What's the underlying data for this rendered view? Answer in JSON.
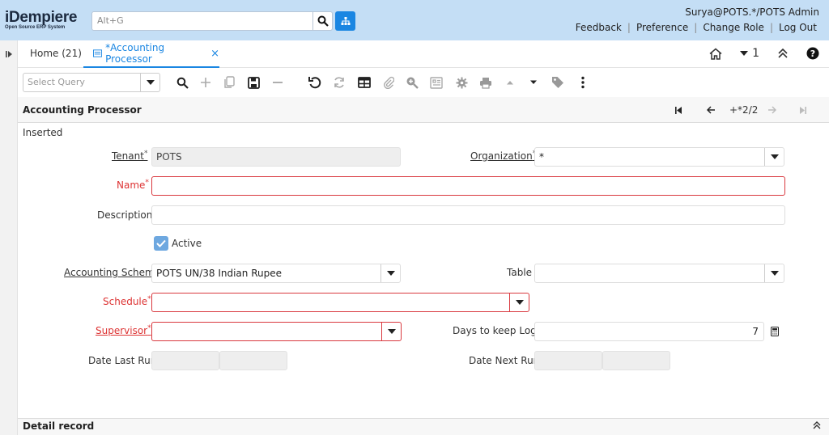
{
  "header": {
    "logo_main": "iDempiere",
    "logo_sub": "Open Source ERP System",
    "search_placeholder": "Alt+G",
    "user": "Surya@POTS.*/POTS Admin",
    "links": [
      "Feedback",
      "Preference",
      "Change Role",
      "Log Out"
    ]
  },
  "tabs": {
    "home_label": "Home (21)",
    "active_label": "*Accounting Processor",
    "close_glyph": "×",
    "tab_count": "1"
  },
  "toolbar": {
    "query_placeholder": "Select Query"
  },
  "titlebar": {
    "title": "Accounting Processor",
    "record_nav": "+*2/2"
  },
  "form": {
    "status": "Inserted",
    "tenant_label": "Tenant",
    "tenant_value": "POTS",
    "organization_label": "Organization",
    "organization_value": "*",
    "name_label": "Name",
    "name_value": "",
    "description_label": "Description",
    "description_value": "",
    "active_label": "Active",
    "active_checked": true,
    "accounting_schema_label": "Accounting Schema",
    "accounting_schema_value": "POTS UN/38 Indian Rupee",
    "table_label": "Table",
    "table_value": "",
    "schedule_label": "Schedule",
    "schedule_value": "",
    "supervisor_label": "Supervisor",
    "supervisor_value": "",
    "days_keep_log_label": "Days to keep Log",
    "days_keep_log_value": "7",
    "date_last_run_label": "Date Last Run",
    "date_next_run_label": "Date Next Run",
    "required_marker": "*"
  },
  "detail": {
    "title": "Detail record"
  },
  "colors": {
    "header_bg": "#c4def5",
    "accent": "#1a86e2",
    "error": "#d9383e"
  }
}
